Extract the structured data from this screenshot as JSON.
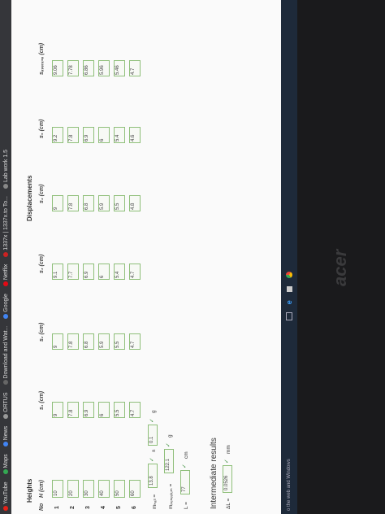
{
  "bookmarks": [
    {
      "label": "YouTube",
      "color": "#e62117"
    },
    {
      "label": "Maps",
      "color": "#34a853"
    },
    {
      "label": "News",
      "color": "#4285f4"
    },
    {
      "label": "ORTUS",
      "color": "#999999"
    },
    {
      "label": "Download and Wat...",
      "color": "#666666"
    },
    {
      "label": "Google",
      "color": "#4285f4"
    },
    {
      "label": "Netflix",
      "color": "#e50914"
    },
    {
      "label": "1337x | 1337x.to To...",
      "color": "#cc2222"
    },
    {
      "label": "Lab work 1.5",
      "color": "#888888"
    }
  ],
  "heights_title": "Heights",
  "displacements_title": "Displacements",
  "columns": {
    "no": "No",
    "h": "H (cm)",
    "s1": "s₁ (cm)",
    "s2": "s₂ (cm)",
    "s3": "s₃ (cm)",
    "s4": "s₄ (cm)",
    "s5": "s₅ (cm)",
    "savg": "sₐᵥₑᵣₐ₉ₑ (cm)"
  },
  "rows": [
    {
      "no": "1",
      "h": "10",
      "s1": "9",
      "s2": "9",
      "s3": "9.1",
      "s4": "9",
      "s5": "9.2",
      "savg": "9.06"
    },
    {
      "no": "2",
      "h": "20",
      "s1": "7.8",
      "s2": "7.8",
      "s3": "7.7",
      "s4": "7.8",
      "s5": "7.8",
      "savg": "7.78"
    },
    {
      "no": "3",
      "h": "30",
      "s1": "6.9",
      "s2": "6.8",
      "s3": "6.9",
      "s4": "6.8",
      "s5": "6.9",
      "savg": "6.86"
    },
    {
      "no": "4",
      "h": "40",
      "s1": "6",
      "s2": "5.9",
      "s3": "6",
      "s4": "5.9",
      "s5": "6",
      "savg": "5.96"
    },
    {
      "no": "5",
      "h": "50",
      "s1": "5.5",
      "s2": "5.5",
      "s3": "5.4",
      "s4": "5.5",
      "s5": "5.4",
      "savg": "5.46"
    },
    {
      "no": "6",
      "h": "60",
      "s1": "4.7",
      "s2": "4.7",
      "s3": "4.7",
      "s4": "4.8",
      "s5": "4.6",
      "savg": "4.7"
    }
  ],
  "mball": {
    "label": "mₕₐₗₗ =",
    "value": "13.8",
    "pm": "±",
    "err": "0.1",
    "unit": "g"
  },
  "mpendulum": {
    "label": "mₚₑₙₑᵤₗᵤₘ =",
    "value": "122.1",
    "unit": "g"
  },
  "length": {
    "label": "L =",
    "value": "77",
    "unit": "cm"
  },
  "intermediate_title": "Intermediate results",
  "delta_l": {
    "label": "ΔL =",
    "value": "0.0526",
    "unit": "mm"
  },
  "taskbar_text": "o the web and Windows",
  "laptop_brand": "acer"
}
